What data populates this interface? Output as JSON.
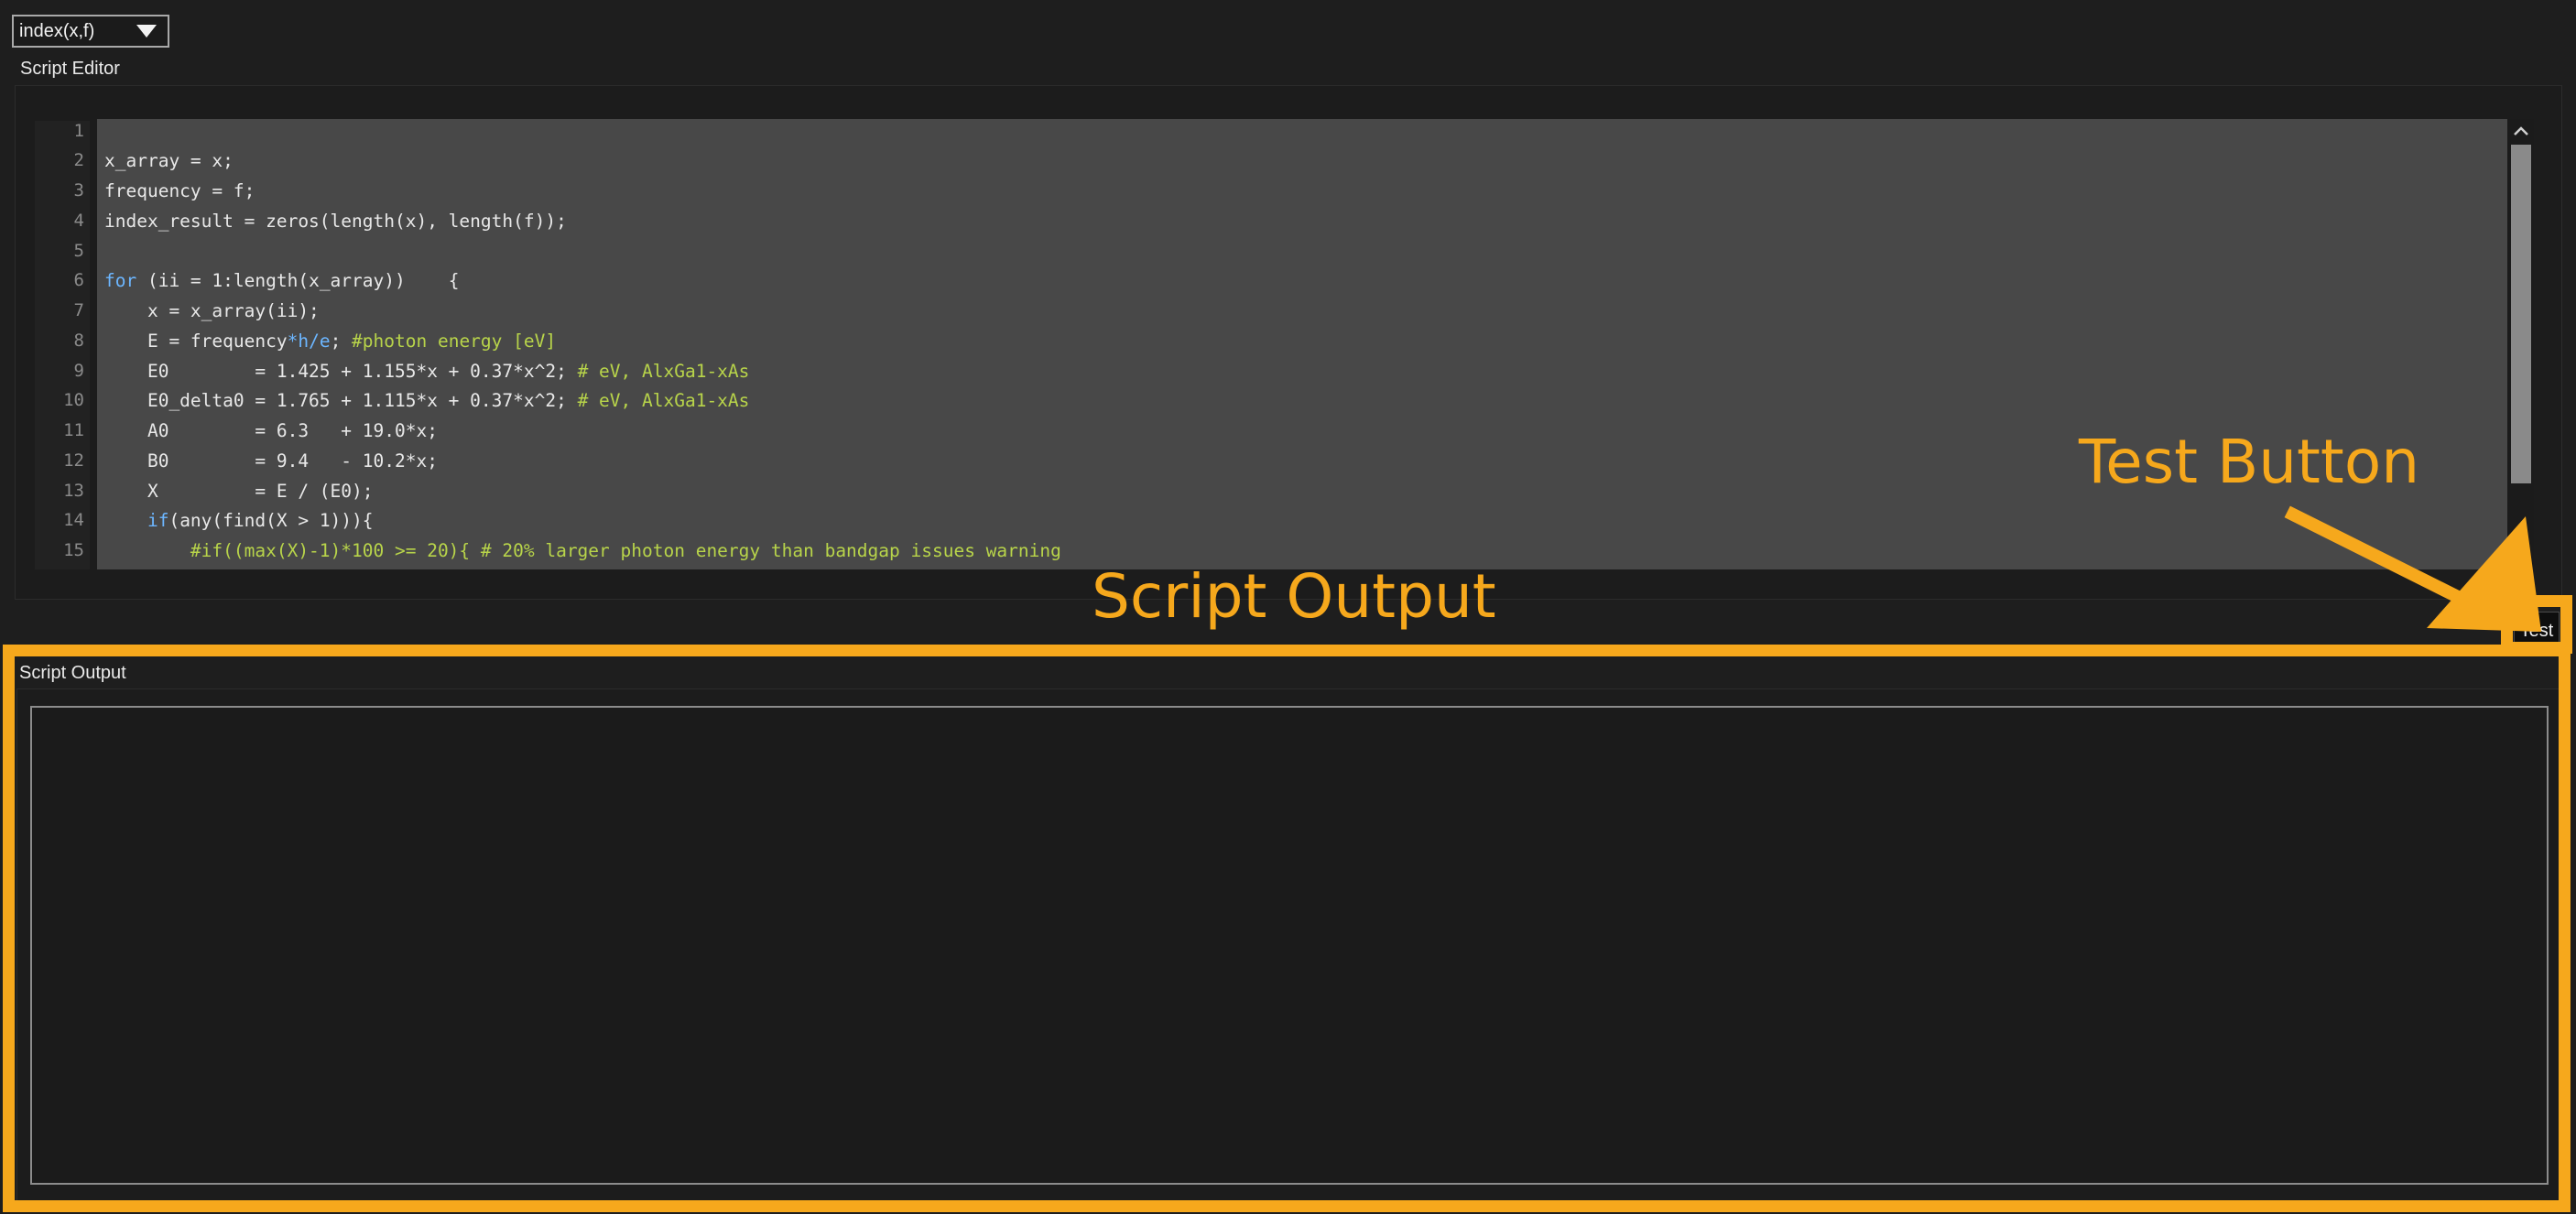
{
  "dropdown": {
    "value": "index(x,f)"
  },
  "editor": {
    "label": "Script Editor",
    "line_numbers": [
      "1",
      "2",
      "3",
      "4",
      "5",
      "6",
      "7",
      "8",
      "9",
      "10",
      "11",
      "12",
      "13",
      "14",
      "15"
    ],
    "lines": [
      "",
      "x_array = x;",
      "frequency = f;",
      "index_result = zeros(length(x), length(f));",
      "",
      "for (ii = 1:length(x_array))    {",
      "    x = x_array(ii);",
      "    E = frequency*h/e; #photon energy [eV]",
      "    E0        = 1.425 + 1.155*x + 0.37*x^2; # eV, AlxGa1-xAs",
      "    E0_delta0 = 1.765 + 1.115*x + 0.37*x^2; # eV, AlxGa1-xAs",
      "    A0        = 6.3   + 19.0*x;",
      "    B0        = 9.4   - 10.2*x;",
      "    X         = E / (E0);",
      "    if(any(find(X > 1))){",
      "        #if((max(X)-1)*100 >= 20){ # 20% larger photon energy than bandgap issues warning"
    ]
  },
  "test_button": {
    "label": "Test"
  },
  "output": {
    "label": "Script Output",
    "content": ""
  },
  "annotations": {
    "test_button_label": "Test Button",
    "script_output_label": "Script Output",
    "color": "#f6a81c"
  },
  "icons": {
    "dropdown": "chevron-down-icon",
    "scroll_up": "chevron-up-icon",
    "scroll_down": "chevron-down-icon"
  }
}
